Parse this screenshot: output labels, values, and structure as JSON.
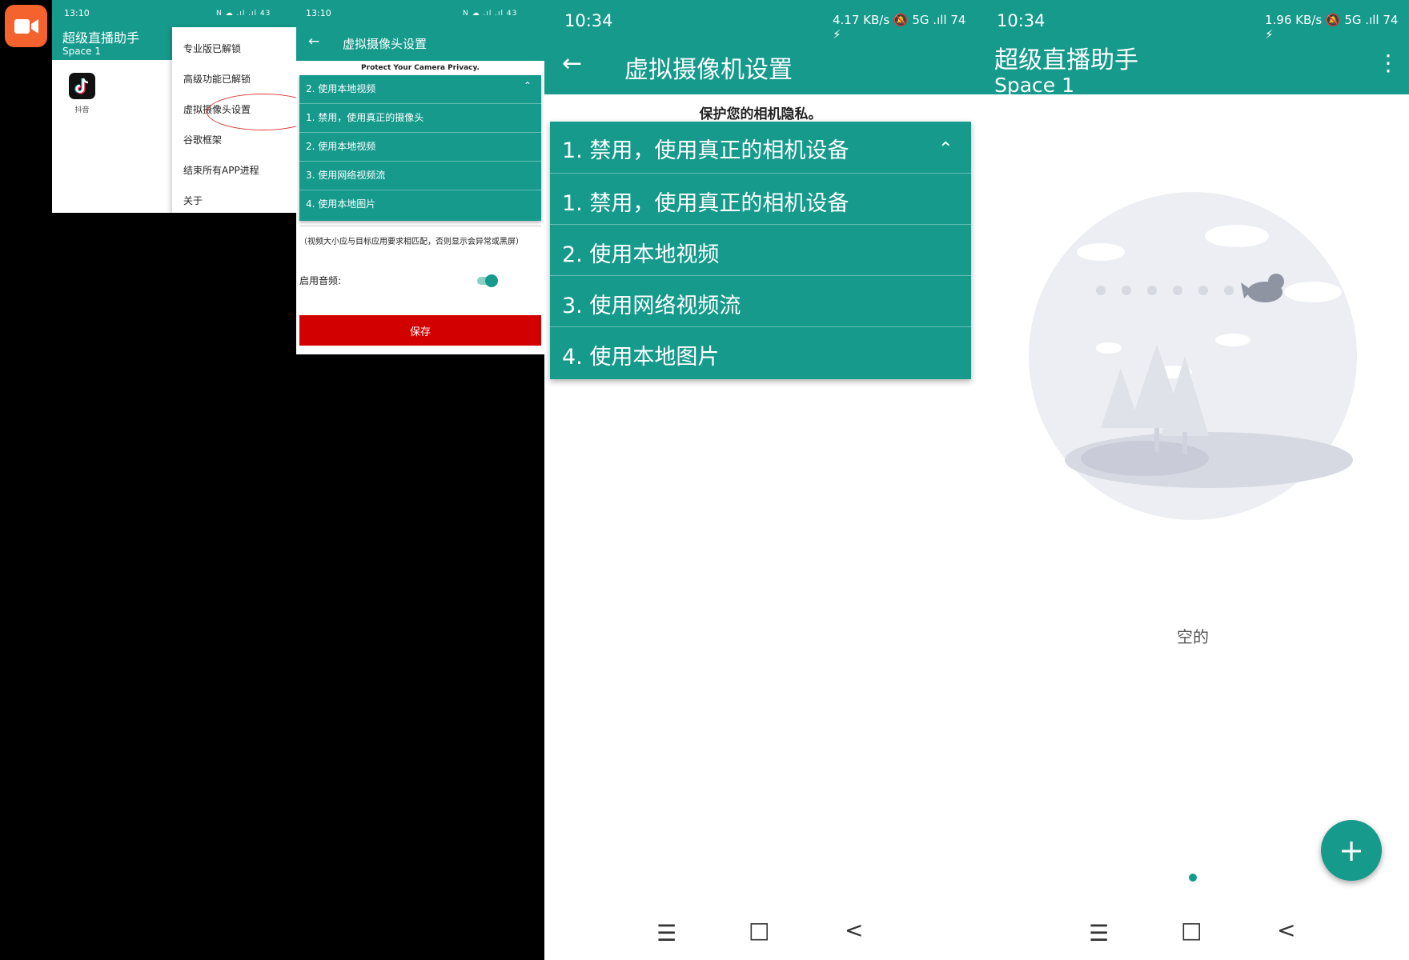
{
  "colors": {
    "accent": "#159a8c",
    "save": "#d30000",
    "app_icon": "#f4622e"
  },
  "panel1": {
    "time": "13:10",
    "status_icons": "N ☁ .ıl .ıl 43",
    "title": "超级直播助手",
    "subtitle": "Space 1",
    "app_label": "抖音",
    "menu": [
      "专业版已解锁",
      "高级功能已解锁",
      "虚拟摄像头设置",
      "谷歌框架",
      "结束所有APP进程",
      "关于"
    ]
  },
  "panel2": {
    "time": "13:10",
    "status_icons": "N ☁ .ıl .ıl 43",
    "title": "虚拟摄像头设置",
    "privacy": "Protect Your Camera Privacy.",
    "selected": "2. 使用本地视频",
    "options": [
      "1. 禁用，使用真正的摄像头",
      "2. 使用本地视频",
      "3. 使用网络视频流",
      "4. 使用本地图片"
    ],
    "hint": "（视频大小应与目标应用要求相匹配，否则显示会异常或黑屏）",
    "audio_label": "启用音频:",
    "save": "保存"
  },
  "panel3": {
    "time": "10:34",
    "status_icons": "4.17 KB/s 🔕 5G .ıll 74 ⚡",
    "title": "虚拟摄像机设置",
    "privacy": "保护您的相机隐私。",
    "selected": "1. 禁用，使用真正的相机设备",
    "options": [
      "1. 禁用，使用真正的相机设备",
      "2. 使用本地视频",
      "3. 使用网络视频流",
      "4. 使用本地图片"
    ]
  },
  "panel4": {
    "time": "10:34",
    "status_icons": "1.96 KB/s 🔕 5G .ıll 74 ⚡",
    "title": "超级直播助手",
    "subtitle": "Space 1",
    "empty": "空的",
    "fab": "+"
  },
  "nav": {
    "menu": "☰",
    "home": "□",
    "back": "<"
  }
}
